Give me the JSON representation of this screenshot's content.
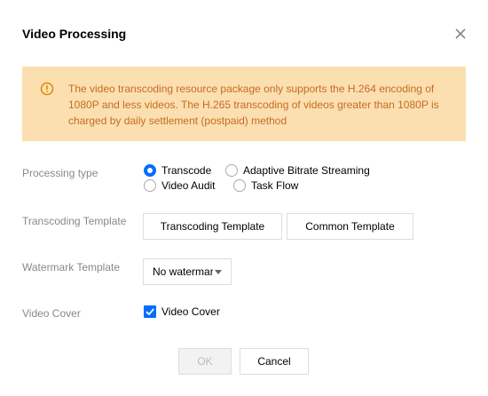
{
  "dialog": {
    "title": "Video Processing"
  },
  "alert": {
    "icon": "warning-circle-icon",
    "text": "The video transcoding resource package only supports the H.264 encoding of 1080P and less videos. The H.265 transcoding of videos greater than 1080P is charged by daily settlement (postpaid) method",
    "color": "#c66c1f",
    "background": "#fbdfb1"
  },
  "processing_type": {
    "label": "Processing type",
    "options": [
      {
        "label": "Transcode",
        "checked": true
      },
      {
        "label": "Adaptive Bitrate Streaming",
        "checked": false
      },
      {
        "label": "Video Audit",
        "checked": false
      },
      {
        "label": "Task Flow",
        "checked": false
      }
    ]
  },
  "transcoding_template": {
    "label": "Transcoding Template",
    "buttons": [
      "Transcoding Template",
      "Common Template"
    ]
  },
  "watermark_template": {
    "label": "Watermark Template",
    "selected": "No watermark"
  },
  "video_cover": {
    "label": "Video Cover",
    "checkbox_label": "Video Cover",
    "checked": true
  },
  "footer": {
    "ok_label": "OK",
    "cancel_label": "Cancel"
  },
  "colors": {
    "accent": "#006eff",
    "label": "#888888"
  }
}
